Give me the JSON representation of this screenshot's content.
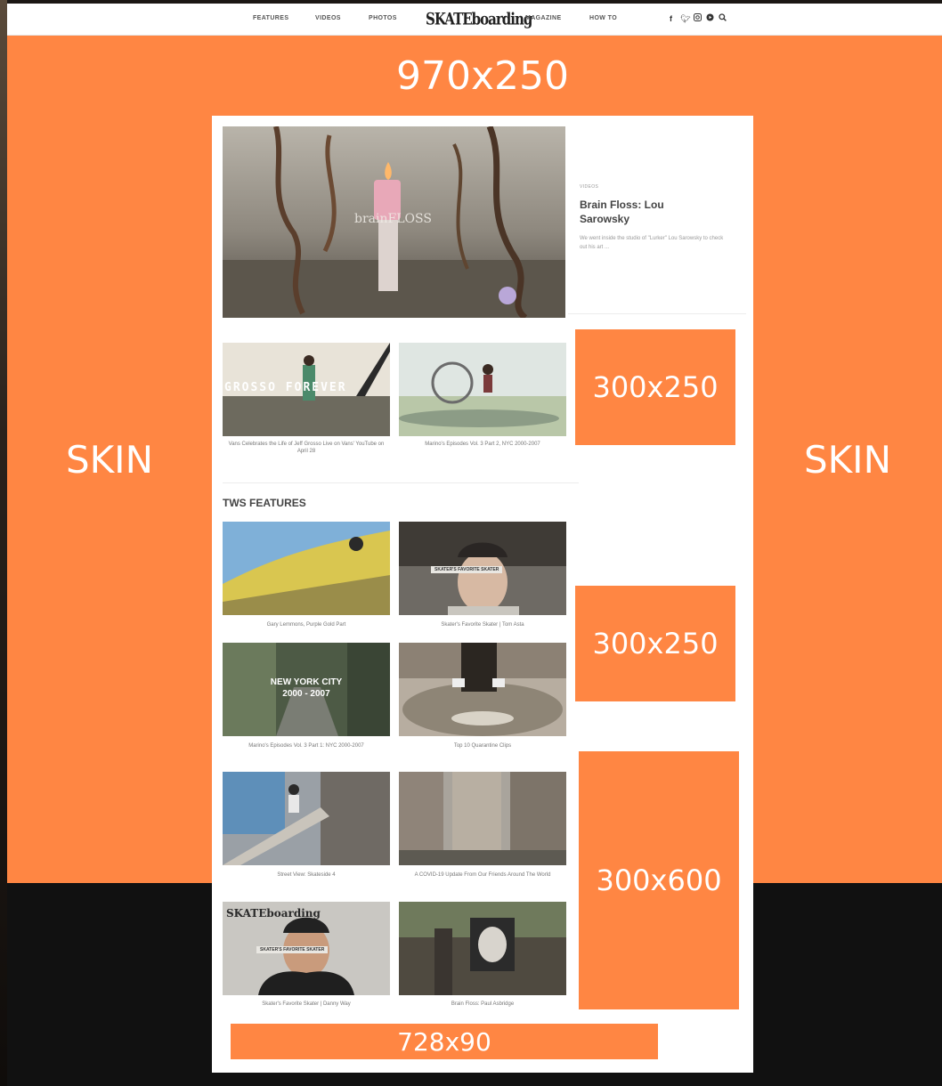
{
  "nav": {
    "items": [
      "FEATURES",
      "VIDEOS",
      "PHOTOS",
      "MAGAZINE",
      "HOW TO"
    ],
    "logo": "SKATEboarding",
    "social_icons": [
      "facebook-icon",
      "twitter-icon",
      "instagram-icon",
      "youtube-icon",
      "search-icon"
    ]
  },
  "ads": {
    "skin_left": "SKIN",
    "skin_right": "SKIN",
    "leaderboard_top": "970x250",
    "rect_1": "300x250",
    "rect_2": "300x250",
    "half_page": "300x600",
    "leaderboard_bottom": "728x90"
  },
  "hero": {
    "overlay": "brainFLOSS",
    "tag": "VIDEOS",
    "title": "Brain Floss: Lou Sarowsky",
    "description": "We went inside the studio of \"Lurker\" Lou Sarowsky to check out his art ..."
  },
  "row_videos": [
    {
      "overlay": "GROSSO FOREVER",
      "caption": "Vans Celebrates the Life of Jeff Grosso Live on Vans' YouTube on April 28"
    },
    {
      "overlay": "",
      "caption": "Marino's Episodes Vol. 3 Part 2, NYC 2000-2007"
    }
  ],
  "features": {
    "title": "TWS FEATURES",
    "items": [
      {
        "overlay": "",
        "caption": "Gary Lemmons, Purple Gold Part"
      },
      {
        "overlay": "SKATER'S FAVORITE SKATER",
        "caption": "Skater's Favorite Skater | Tom Asta"
      },
      {
        "overlay": "NEW YORK CITY 2000 - 2007",
        "caption": "Marino's Episodes Vol. 3 Part 1: NYC 2000-2007"
      },
      {
        "overlay": "",
        "caption": "Top 10 Quarantine Clips"
      },
      {
        "overlay": "",
        "caption": "Street View: Skateside 4"
      },
      {
        "overlay": "",
        "caption": "A COVID-19 Update From Our Friends Around The World"
      },
      {
        "overlay": "SKATER'S FAVORITE SKATER",
        "caption": "Skater's Favorite Skater | Danny Way"
      },
      {
        "overlay": "",
        "caption": "Brain Floss: Paul Asbridge"
      }
    ]
  },
  "colors": {
    "ad_orange": "#ff8643",
    "page_white": "#ffffff"
  }
}
